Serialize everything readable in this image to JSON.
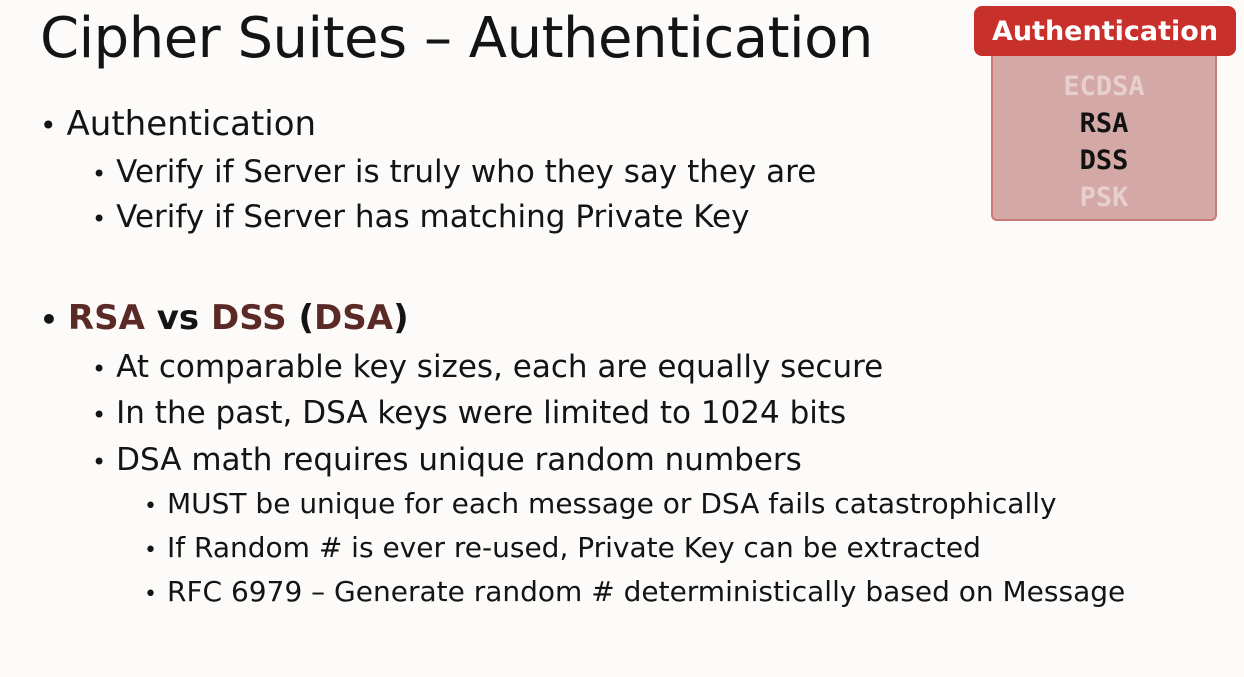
{
  "slide": {
    "title": "Cipher Suites – Authentication",
    "bullet_glyph": "•",
    "authentication": {
      "heading": "Authentication",
      "points": [
        "Verify if Server is truly who they say they are",
        "Verify if Server has matching Private Key"
      ]
    },
    "comparison": {
      "term_a": "RSA",
      "vs": " vs ",
      "term_b": "DSS",
      "paren_open": " (",
      "term_c": "DSA",
      "paren_close": ")",
      "points": [
        "At comparable key sizes, each are equally secure",
        "In the past, DSA keys were limited to 1024 bits",
        "DSA math requires unique random numbers"
      ],
      "sub_points": [
        "MUST be unique for each message or DSA fails catastrophically",
        "If Random # is ever re-used, Private Key can be extracted",
        "RFC 6979 – Generate random # deterministically based on Message"
      ]
    }
  },
  "auth_panel": {
    "header": "Authentication",
    "options": [
      {
        "label": "ECDSA",
        "active": false
      },
      {
        "label": "RSA",
        "active": true
      },
      {
        "label": "DSS",
        "active": true
      },
      {
        "label": "PSK",
        "active": false
      }
    ]
  },
  "colors": {
    "background": "#fcfbf9",
    "text": "#141414",
    "highlight": "#5c2a26",
    "panel_header": "#c7302b",
    "panel_body": "#d4a8a4",
    "panel_active": "#111111",
    "panel_inactive": "#e6cfcc"
  }
}
